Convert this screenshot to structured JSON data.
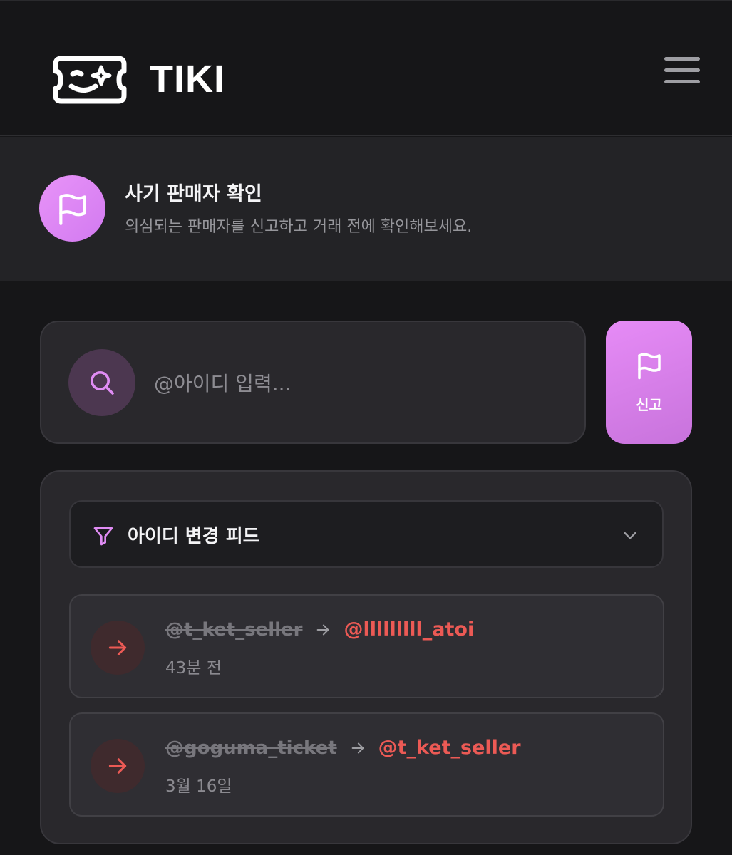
{
  "header": {
    "brand": "TIKI",
    "logo_icon": "ticket-smile-icon",
    "menu_icon": "hamburger-menu-icon"
  },
  "banner": {
    "icon": "flag-icon",
    "title": "사기 판매자 확인",
    "subtitle": "의심되는 판매자를 신고하고 거래 전에 확인해보세요."
  },
  "search": {
    "icon": "search-icon",
    "placeholder": "@아이디 입력...",
    "value": ""
  },
  "report_button": {
    "icon": "flag-icon",
    "label": "신고"
  },
  "feed": {
    "filter_icon": "filter-icon",
    "selected_label": "아이디 변경 피드",
    "chevron_icon": "chevron-down-icon",
    "items": [
      {
        "old_id": "@t_ket_seller",
        "new_id": "@lllllllll_atoi",
        "time": "43분 전"
      },
      {
        "old_id": "@goguma_ticket",
        "new_id": "@t_ket_seller",
        "time": "3월 16일"
      }
    ]
  },
  "colors": {
    "background": "#161618",
    "banner_bg": "#232326",
    "accent_pink": "#e68bf6",
    "new_id_red": "#ec5a55"
  }
}
